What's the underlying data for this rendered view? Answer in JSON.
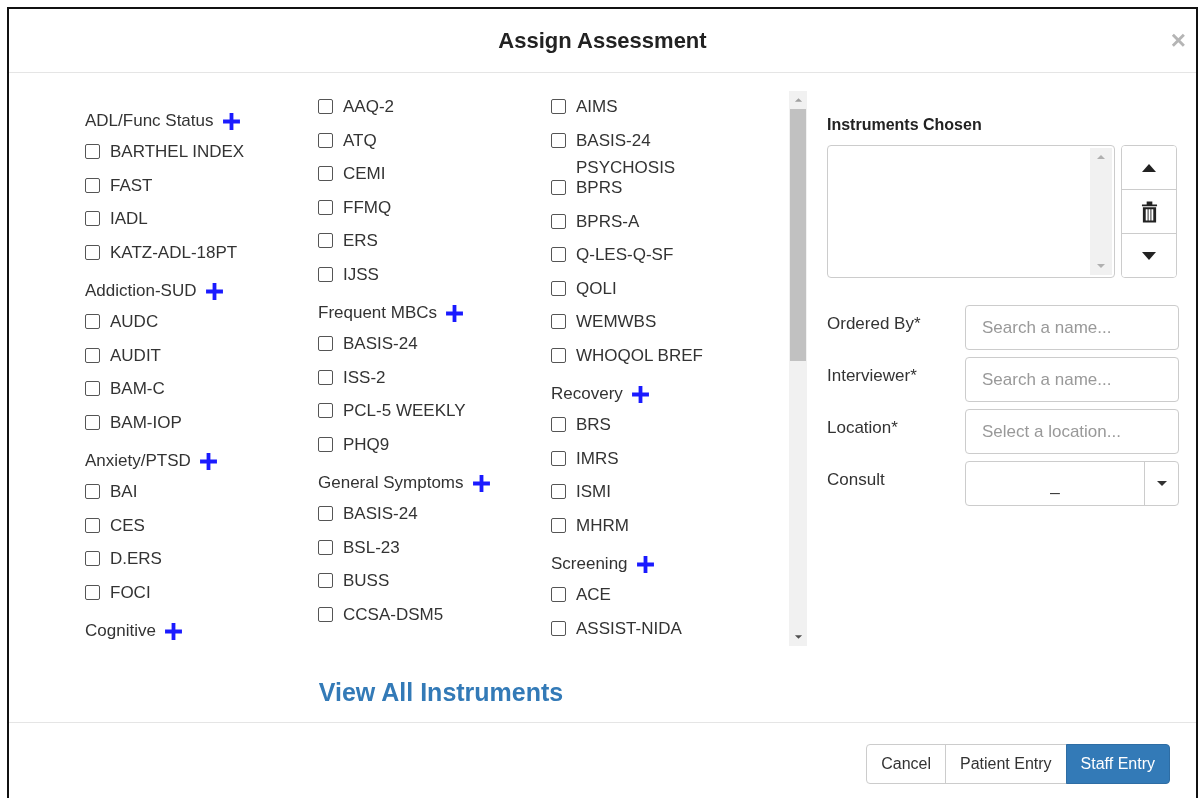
{
  "dialog": {
    "title": "Assign Assessment",
    "close": "×"
  },
  "instrument_columns": [
    [
      {
        "kind": "group",
        "label": "ADL/Func Status"
      },
      {
        "kind": "checkbox",
        "label": "BARTHEL INDEX",
        "checked": false
      },
      {
        "kind": "checkbox",
        "label": "FAST",
        "checked": false
      },
      {
        "kind": "checkbox",
        "label": "IADL",
        "checked": false
      },
      {
        "kind": "checkbox",
        "label": "KATZ-ADL-18PT",
        "checked": false
      },
      {
        "kind": "group",
        "label": "Addiction-SUD"
      },
      {
        "kind": "checkbox",
        "label": "AUDC",
        "checked": false
      },
      {
        "kind": "checkbox",
        "label": "AUDIT",
        "checked": false
      },
      {
        "kind": "checkbox",
        "label": "BAM-C",
        "checked": false
      },
      {
        "kind": "checkbox",
        "label": "BAM-IOP",
        "checked": false
      },
      {
        "kind": "group",
        "label": "Anxiety/PTSD"
      },
      {
        "kind": "checkbox",
        "label": "BAI",
        "checked": false
      },
      {
        "kind": "checkbox",
        "label": "CES",
        "checked": false
      },
      {
        "kind": "checkbox",
        "label": "D.ERS",
        "checked": false
      },
      {
        "kind": "checkbox",
        "label": "FOCI",
        "checked": false
      },
      {
        "kind": "group",
        "label": "Cognitive"
      }
    ],
    [
      {
        "kind": "checkbox",
        "label": "AAQ-2",
        "checked": false
      },
      {
        "kind": "checkbox",
        "label": "ATQ",
        "checked": false
      },
      {
        "kind": "checkbox",
        "label": "CEMI",
        "checked": false
      },
      {
        "kind": "checkbox",
        "label": "FFMQ",
        "checked": false
      },
      {
        "kind": "checkbox",
        "label": "ERS",
        "checked": false
      },
      {
        "kind": "checkbox",
        "label": "IJSS",
        "checked": false
      },
      {
        "kind": "group",
        "label": "Frequent MBCs"
      },
      {
        "kind": "checkbox",
        "label": "BASIS-24",
        "checked": false
      },
      {
        "kind": "checkbox",
        "label": "ISS-2",
        "checked": false
      },
      {
        "kind": "checkbox",
        "label": "PCL-5 WEEKLY",
        "checked": false
      },
      {
        "kind": "checkbox",
        "label": "PHQ9",
        "checked": false
      },
      {
        "kind": "group",
        "label": "General Symptoms"
      },
      {
        "kind": "checkbox",
        "label": "BASIS-24",
        "checked": false
      },
      {
        "kind": "checkbox",
        "label": "BSL-23",
        "checked": false
      },
      {
        "kind": "checkbox",
        "label": "BUSS",
        "checked": false
      },
      {
        "kind": "checkbox",
        "label": "CCSA-DSM5",
        "checked": false
      }
    ],
    [
      {
        "kind": "checkbox",
        "label": "AIMS",
        "checked": false
      },
      {
        "kind": "checkbox",
        "label": "BASIS-24 PSYCHOSIS",
        "checked": false
      },
      {
        "kind": "checkbox",
        "label": "BPRS",
        "checked": false
      },
      {
        "kind": "checkbox",
        "label": "BPRS-A",
        "checked": false
      },
      {
        "kind": "checkbox",
        "label": "Q-LES-Q-SF",
        "checked": false
      },
      {
        "kind": "checkbox",
        "label": "QOLI",
        "checked": false
      },
      {
        "kind": "checkbox",
        "label": "WEMWBS",
        "checked": false
      },
      {
        "kind": "checkbox",
        "label": "WHOQOL BREF",
        "checked": false
      },
      {
        "kind": "group",
        "label": "Recovery"
      },
      {
        "kind": "checkbox",
        "label": "BRS",
        "checked": false
      },
      {
        "kind": "checkbox",
        "label": "IMRS",
        "checked": false
      },
      {
        "kind": "checkbox",
        "label": "ISMI",
        "checked": false
      },
      {
        "kind": "checkbox",
        "label": "MHRM",
        "checked": false
      },
      {
        "kind": "group",
        "label": "Screening"
      },
      {
        "kind": "checkbox",
        "label": "ACE",
        "checked": false
      },
      {
        "kind": "checkbox",
        "label": "ASSIST-NIDA",
        "checked": false
      }
    ]
  ],
  "view_all_link": "View All Instruments",
  "instruments_chosen": {
    "label": "Instruments Chosen"
  },
  "form": [
    {
      "kind": "input",
      "label": "Ordered By*",
      "placeholder": "Search a name..."
    },
    {
      "kind": "input",
      "label": "Interviewer*",
      "placeholder": "Search a name..."
    },
    {
      "kind": "input",
      "label": "Location*",
      "placeholder": "Select a location..."
    },
    {
      "kind": "select",
      "label": "Consult",
      "value": "_"
    }
  ],
  "buttons": [
    {
      "label": "Cancel",
      "primary": false
    },
    {
      "label": "Patient Entry",
      "primary": false
    },
    {
      "label": "Staff Entry",
      "primary": true
    }
  ]
}
